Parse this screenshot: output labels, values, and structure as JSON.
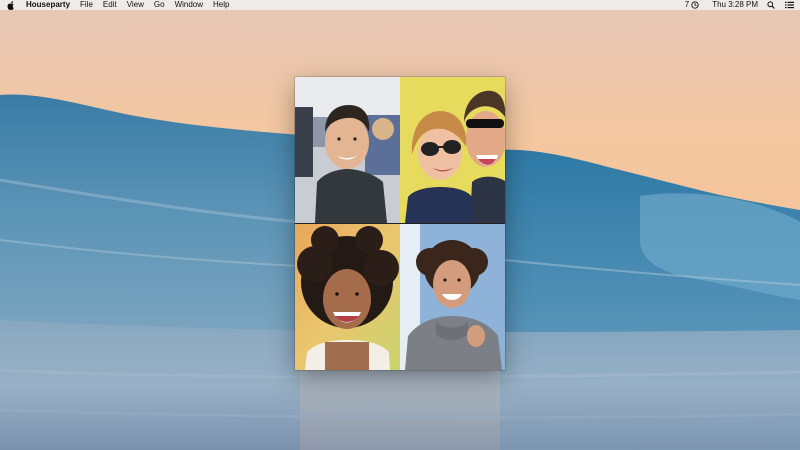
{
  "menubar": {
    "app_name": "Houseparty",
    "items": [
      "File",
      "Edit",
      "View",
      "Go",
      "Window",
      "Help"
    ],
    "status_number": "7",
    "clock": "Thu 3:28 PM"
  },
  "icons": {
    "apple": "apple-logo-icon",
    "history": "time-machine-icon",
    "search": "spotlight-search-icon",
    "menu": "notification-center-icon"
  },
  "video_call": {
    "participants": 4
  },
  "colors": {
    "menubar_bg": "#f0eeec",
    "wave_blue": "#3f7ea6",
    "sky_peach": "#f4c59c"
  }
}
